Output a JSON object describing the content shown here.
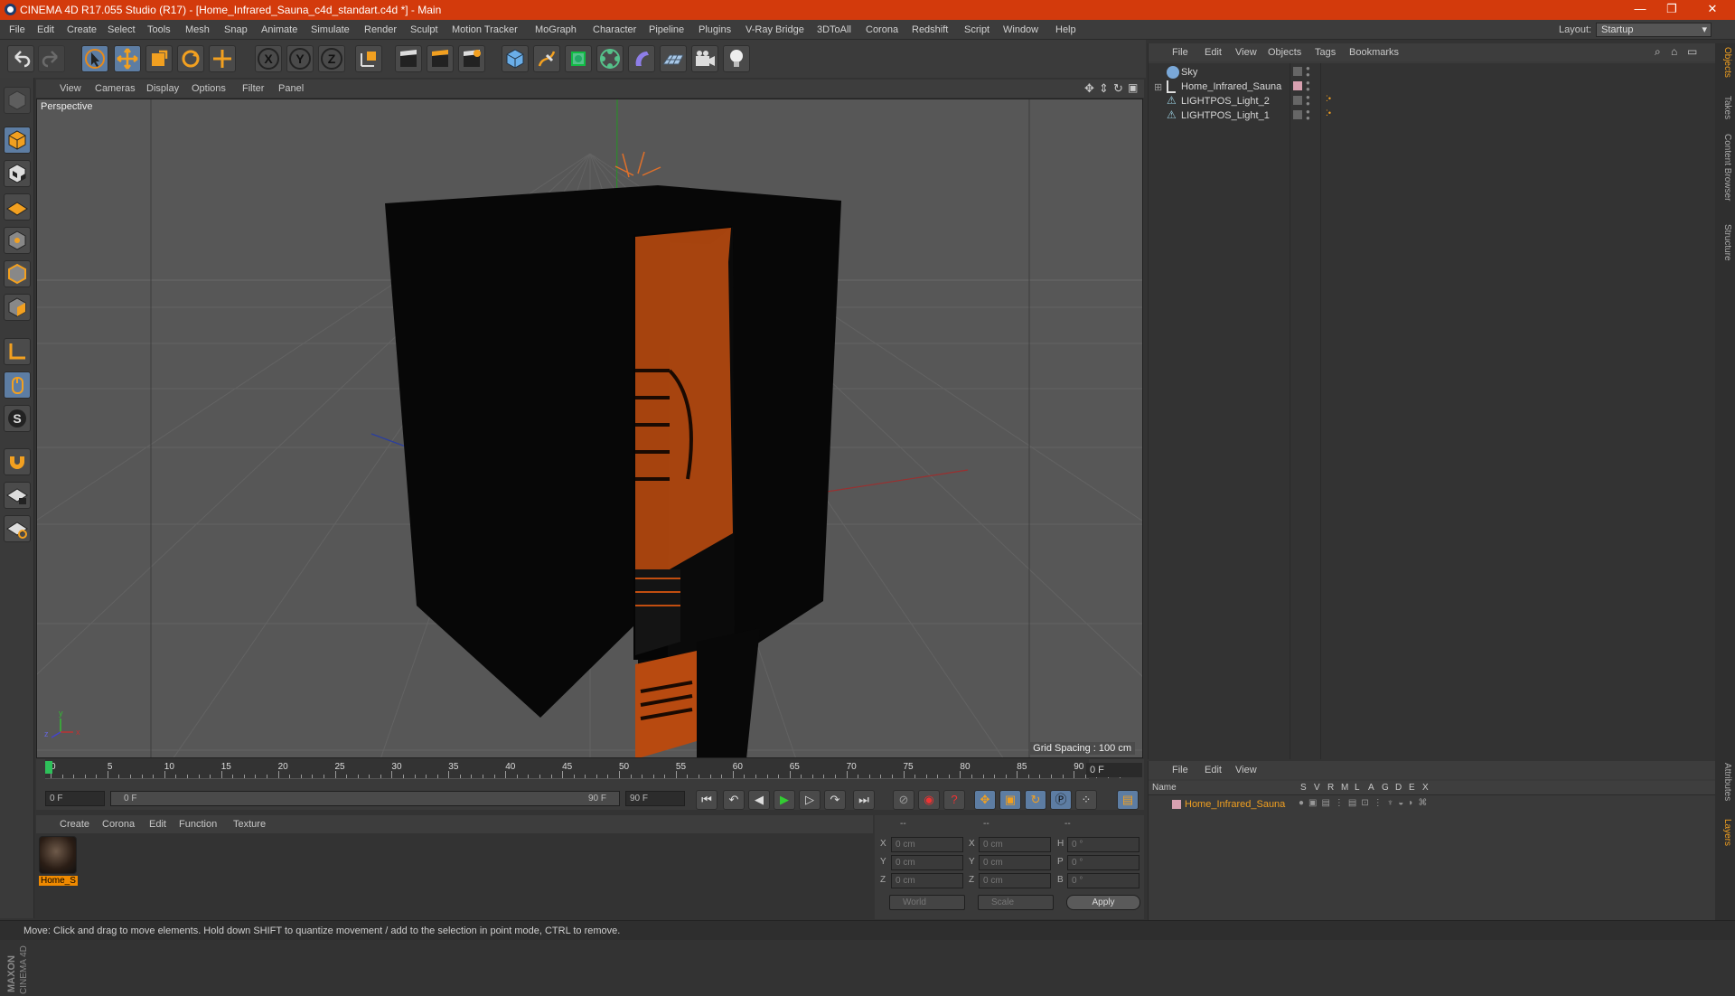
{
  "titlebar": {
    "title": "CINEMA 4D R17.055 Studio (R17) - [Home_Infrared_Sauna_c4d_standart.c4d *] - Main",
    "minimize": "—",
    "restore": "❐",
    "close": "✕"
  },
  "menubar": {
    "items": [
      "File",
      "Edit",
      "Create",
      "Select",
      "Tools",
      "Mesh",
      "Snap",
      "Animate",
      "Simulate",
      "Render",
      "Sculpt",
      "Motion Tracker",
      "MoGraph",
      "Character",
      "Pipeline",
      "Plugins",
      "V-Ray Bridge",
      "3DToAll",
      "Corona",
      "Redshift",
      "Script",
      "Window",
      "Help"
    ],
    "layout_label": "Layout:",
    "layout_value": "Startup"
  },
  "viewport": {
    "menu": [
      "View",
      "Cameras",
      "Display",
      "Options",
      "Filter",
      "Panel"
    ],
    "label": "Perspective",
    "grid_spacing": "Grid Spacing : 100 cm"
  },
  "timeline": {
    "ticks": [
      "0",
      "5",
      "10",
      "15",
      "20",
      "25",
      "30",
      "35",
      "40",
      "45",
      "50",
      "55",
      "60",
      "65",
      "70",
      "75",
      "80",
      "85",
      "90"
    ],
    "current_frame": "0 F"
  },
  "transport": {
    "start_field": "0 F",
    "range_start": "0 F",
    "range_end": "90 F",
    "end_field": "90 F"
  },
  "material_manager": {
    "menu": [
      "Create",
      "Corona",
      "Edit",
      "Function",
      "Texture"
    ],
    "material_name": "Home_S"
  },
  "coordinates": {
    "header": [
      "--",
      "--",
      "--"
    ],
    "rows": [
      {
        "a": "X",
        "av": "0 cm",
        "b": "X",
        "bv": "0 cm",
        "c": "H",
        "cv": "0 °"
      },
      {
        "a": "Y",
        "av": "0 cm",
        "b": "Y",
        "bv": "0 cm",
        "c": "P",
        "cv": "0 °"
      },
      {
        "a": "Z",
        "av": "0 cm",
        "b": "Z",
        "bv": "0 cm",
        "c": "B",
        "cv": "0 °"
      }
    ],
    "mode_world": "World",
    "mode_scale": "Scale",
    "apply": "Apply"
  },
  "object_manager": {
    "menu": [
      "File",
      "Edit",
      "View",
      "Objects",
      "Tags",
      "Bookmarks"
    ],
    "objects": [
      "Sky",
      "Home_Infrared_Sauna",
      "LIGHTPOS_Light_2",
      "LIGHTPOS_Light_1"
    ]
  },
  "layer_manager": {
    "menu": [
      "File",
      "Edit",
      "View"
    ],
    "columns": [
      "Name",
      "S",
      "V",
      "R",
      "M",
      "L",
      "A",
      "G",
      "D",
      "E",
      "X"
    ],
    "layer_name": "Home_Infrared_Sauna"
  },
  "side_tabs": [
    "Objects",
    "Takes",
    "Content Browser",
    "Structure",
    "Attributes",
    "Layers"
  ],
  "status": "Move: Click and drag to move elements. Hold down SHIFT to quantize movement / add to the selection in point mode, CTRL to remove.",
  "colors": {
    "title_accent": "#d33a0c",
    "selection": "#5d7da3",
    "orange": "#f08a00"
  }
}
